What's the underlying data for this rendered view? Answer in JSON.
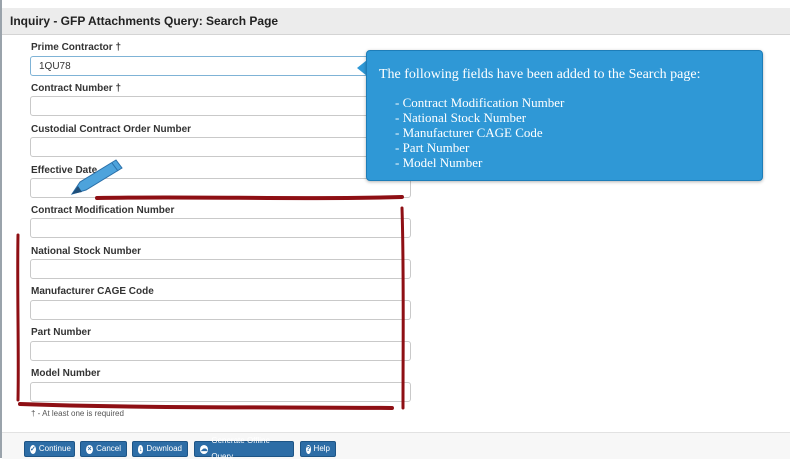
{
  "page": {
    "title": "Inquiry - GFP Attachments Query: Search Page"
  },
  "fields": [
    {
      "label": "Prime Contractor †",
      "value": "1QU78",
      "placeholder": ""
    },
    {
      "label": "Contract Number †",
      "value": "",
      "placeholder": ""
    },
    {
      "label": "Custodial Contract Order Number",
      "value": "",
      "placeholder": ""
    },
    {
      "label": "Effective Date",
      "value": "",
      "placeholder": ""
    },
    {
      "label": "Contract Modification Number",
      "value": "",
      "placeholder": ""
    },
    {
      "label": "National Stock Number",
      "value": "",
      "placeholder": ""
    },
    {
      "label": "Manufacturer CAGE Code",
      "value": "",
      "placeholder": ""
    },
    {
      "label": "Part Number",
      "value": "",
      "placeholder": ""
    },
    {
      "label": "Model Number",
      "value": "",
      "placeholder": ""
    }
  ],
  "required_note": "† - At least one is required",
  "tooltip": {
    "heading": "The following fields have been added to the Search page:",
    "items": [
      "- Contract Modification Number",
      "- National Stock Number",
      "- Manufacturer CAGE Code",
      "- Part Number",
      "- Model Number"
    ]
  },
  "buttons": {
    "continue": "Continue",
    "cancel": "Cancel",
    "download": "Download",
    "generate_offline": "Generate Offline Query",
    "help": "Help"
  },
  "icons": {
    "continue": "check-circle-icon",
    "cancel": "x-circle-icon",
    "download": "download-icon",
    "generate_offline": "cloud-icon",
    "help": "question-circle-icon",
    "annotation": "pencil-icon"
  },
  "colors": {
    "button_bg": "#2d6da6",
    "tooltip_bg": "#2f98d6",
    "annotation_red": "#8e0f14"
  }
}
